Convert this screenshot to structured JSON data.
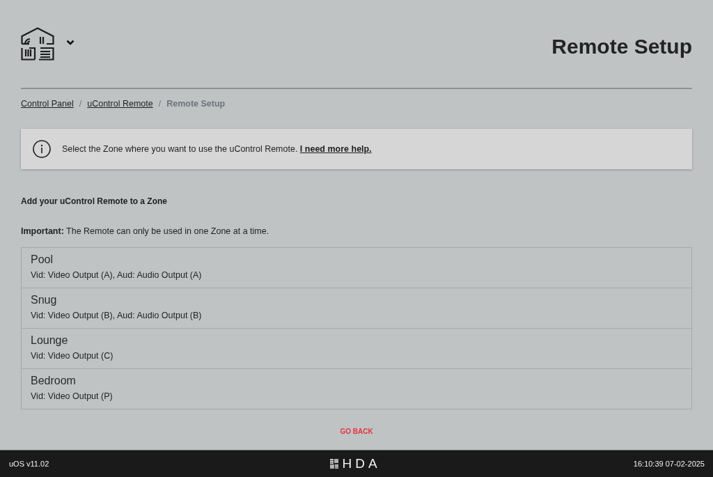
{
  "header": {
    "title": "Remote Setup"
  },
  "breadcrumb": {
    "separator": "/",
    "items": [
      {
        "label": "Control Panel",
        "current": false
      },
      {
        "label": "uControl Remote",
        "current": false
      },
      {
        "label": "Remote Setup",
        "current": true
      }
    ]
  },
  "notice": {
    "text": "Select the Zone where you want to use the uControl Remote.",
    "link": "I need more help."
  },
  "section_title": "Add your uControl Remote to a Zone",
  "important_note": "**Important:** The Remote can only be used in one Zone at a time.",
  "zones": [
    {
      "name": "Pool",
      "outputs": "Vid: Video Output (A), Aud: Audio Output (A)"
    },
    {
      "name": "Snug",
      "outputs": "Vid: Video Output (B), Aud: Audio Output (B)"
    },
    {
      "name": "Lounge",
      "outputs": "Vid: Video Output (C)"
    },
    {
      "name": "Bedroom",
      "outputs": "Vid: Video Output (P)"
    }
  ],
  "back_button": "GO BACK",
  "status_bar": {
    "version": "uOS v11.02",
    "brand": "HDA",
    "datetime": "16:10:39 07-02-2025"
  }
}
